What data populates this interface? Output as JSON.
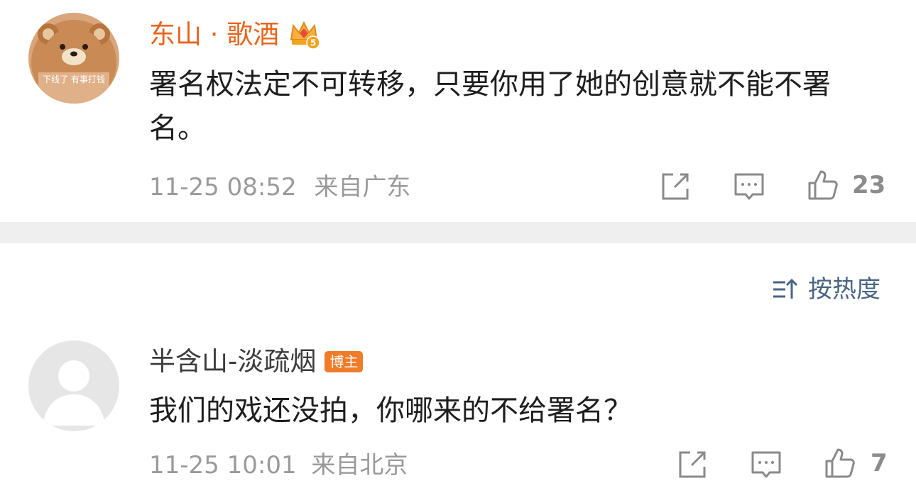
{
  "comments": [
    {
      "username": "东山 · 歌酒",
      "avatar_caption": "下线了 有事打钱",
      "vip_level": "5",
      "text": "署名权法定不可转移，只要你用了她的创意就不能不署名。",
      "time": "11-25 08:52",
      "location": "来自广东",
      "likes": "23"
    },
    {
      "username": "半含山-淡疏烟",
      "badge": "博主",
      "text": "我们的戏还没拍，你哪来的不给署名？",
      "time": "11-25 10:01",
      "location": "来自北京",
      "likes": "7"
    }
  ],
  "sort": {
    "label": "按热度",
    "icon": "sort-icon"
  },
  "colors": {
    "username_highlight": "#e8651e",
    "badge": "#f07b28",
    "sort_text": "#4a6584",
    "divider": "#efefef"
  }
}
